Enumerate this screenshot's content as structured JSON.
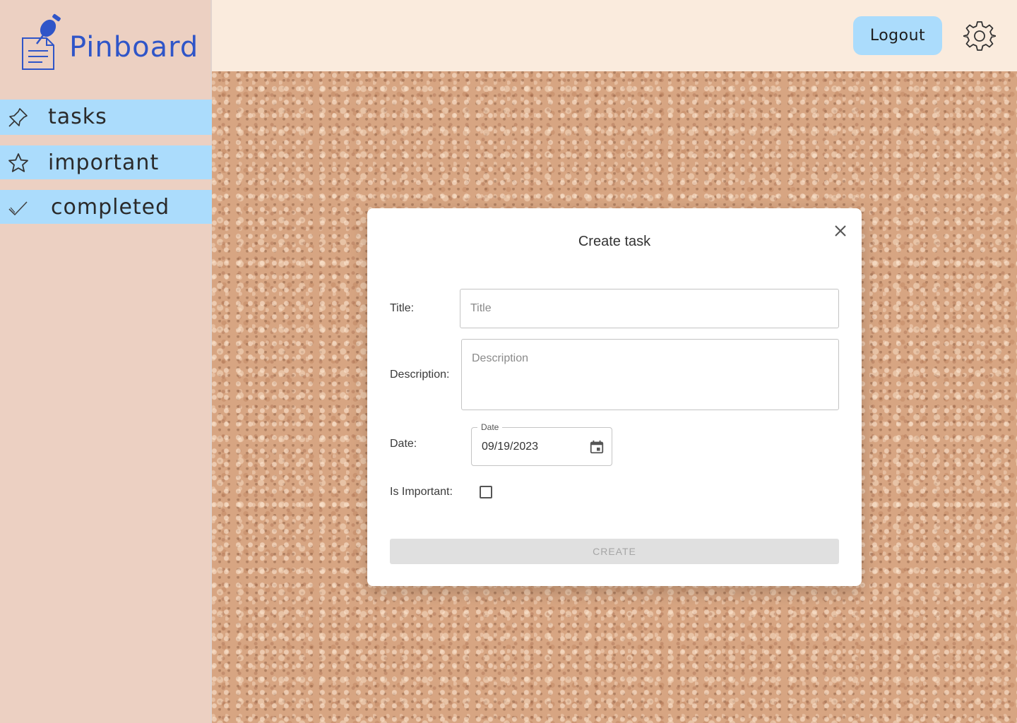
{
  "app": {
    "name": "Pinboard"
  },
  "sidebar": {
    "items": [
      {
        "label": "tasks",
        "icon": "pushpin-icon"
      },
      {
        "label": "important",
        "icon": "star-icon"
      },
      {
        "label": "completed",
        "icon": "checkmark-icon"
      }
    ]
  },
  "header": {
    "logout_label": "Logout",
    "settings_icon": "gear-icon"
  },
  "modal": {
    "title": "Create task",
    "close_icon": "close-icon",
    "fields": {
      "title_label": "Title:",
      "title_placeholder": "Title",
      "title_value": "",
      "description_label": "Description:",
      "description_placeholder": "Description",
      "description_value": "",
      "date_label": "Date:",
      "date_legend": "Date",
      "date_value": "09/19/2023",
      "important_label": "Is Important:",
      "important_checked": false
    },
    "create_label": "CREATE"
  },
  "colors": {
    "brand": "#2f55c8",
    "sidebar_bg": "#ecd0c2",
    "nav_item_bg": "#abdcfc",
    "header_bg": "#faebdd",
    "button_disabled_bg": "#e0e0e0"
  }
}
